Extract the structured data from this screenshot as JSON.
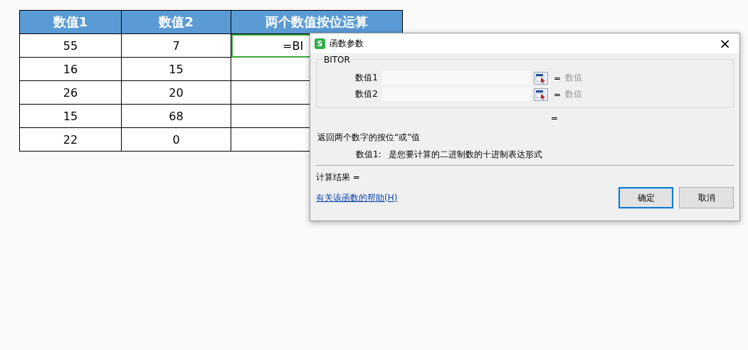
{
  "table": {
    "columns": [
      "数值1",
      "数值2",
      "两个数值按位运算"
    ],
    "rows": [
      {
        "value1": "55",
        "value2": "7",
        "result": {
          "text": "=BI",
          "selected": true
        }
      },
      {
        "value1": "16",
        "value2": "15",
        "result": {
          "selected": false
        }
      },
      {
        "value1": "26",
        "value2": "20",
        "result": {
          "selected": false
        }
      },
      {
        "value1": "15",
        "value2": "68",
        "result": {
          "selected": false
        }
      },
      {
        "value1": "22",
        "value2": "0",
        "result": {
          "selected": false
        }
      }
    ]
  },
  "dialog": {
    "title": "函数参数",
    "app_icon": "S",
    "close": "×",
    "function_name": "BITOR",
    "arguments": [
      {
        "label": "数值1",
        "equals": "=",
        "hint": "数值"
      },
      {
        "label": "数值2",
        "equals": "=",
        "hint": "数值"
      }
    ],
    "formula_equals": "=",
    "description": "返回两个数字的按位“或”值",
    "argument_help": {
      "label": "数值1:",
      "text": "是您要计算的二进制数的十进制表达形式"
    },
    "result_label": "计算结果  =",
    "help_link": "有关该函数的帮助(H)",
    "buttons": [
      {
        "label": "确定",
        "default": true
      },
      {
        "label": "取消",
        "default": false
      }
    ]
  }
}
